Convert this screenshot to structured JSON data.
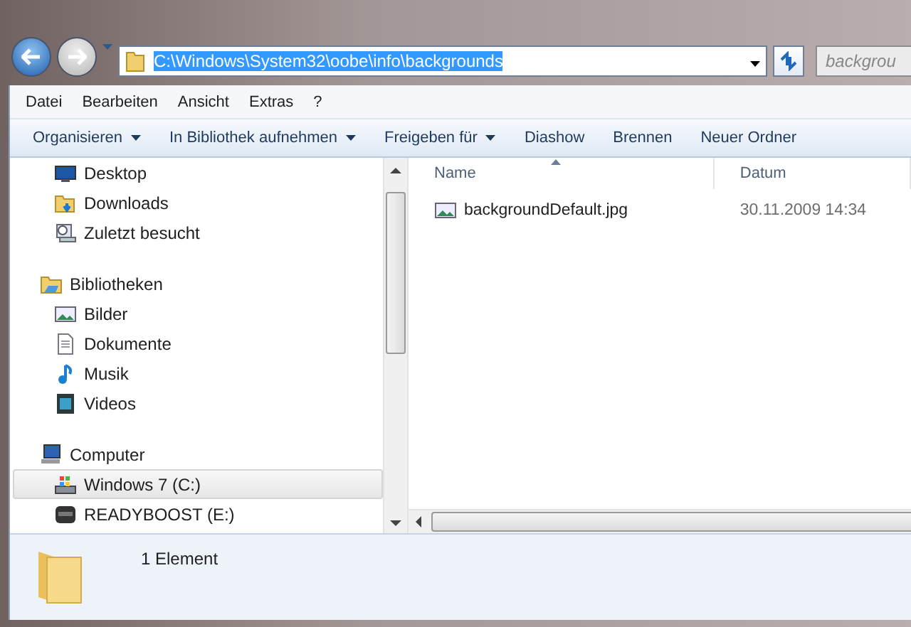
{
  "address": {
    "value": "C:\\Windows\\System32\\oobe\\info\\backgrounds"
  },
  "search": {
    "placeholder": "backgrou"
  },
  "menu": [
    "Datei",
    "Bearbeiten",
    "Ansicht",
    "Extras",
    "?"
  ],
  "commands": [
    {
      "label": "Organisieren",
      "dropdown": true
    },
    {
      "label": "In Bibliothek aufnehmen",
      "dropdown": true
    },
    {
      "label": "Freigeben für",
      "dropdown": true
    },
    {
      "label": "Diashow",
      "dropdown": false
    },
    {
      "label": "Brennen",
      "dropdown": false
    },
    {
      "label": "Neuer Ordner",
      "dropdown": false
    }
  ],
  "navigation": [
    {
      "children": [
        {
          "kind": "desktop",
          "label": "Desktop",
          "selected": false
        },
        {
          "kind": "downloads",
          "label": "Downloads",
          "selected": false
        },
        {
          "kind": "recent",
          "label": "Zuletzt besucht",
          "selected": false
        }
      ]
    },
    {
      "kind": "library",
      "label": "Bibliotheken",
      "selected": false,
      "children": [
        {
          "kind": "pictures",
          "label": "Bilder",
          "selected": false
        },
        {
          "kind": "documents",
          "label": "Dokumente",
          "selected": false
        },
        {
          "kind": "music",
          "label": "Musik",
          "selected": false
        },
        {
          "kind": "videos",
          "label": "Videos",
          "selected": false
        }
      ]
    },
    {
      "kind": "computer",
      "label": "Computer",
      "selected": false,
      "children": [
        {
          "kind": "windrive",
          "label": "Windows 7 (C:)",
          "selected": true
        },
        {
          "kind": "drive",
          "label": "READYBOOST (E:)",
          "selected": false
        }
      ]
    }
  ],
  "table": {
    "columns": [
      {
        "label": "Name",
        "sorted": true
      },
      {
        "label": "Datum",
        "sorted": false
      }
    ],
    "rows": [
      {
        "name": "backgroundDefault.jpg",
        "date": "30.11.2009 14:34"
      }
    ]
  },
  "status_bar": {
    "text": "1 Element"
  }
}
